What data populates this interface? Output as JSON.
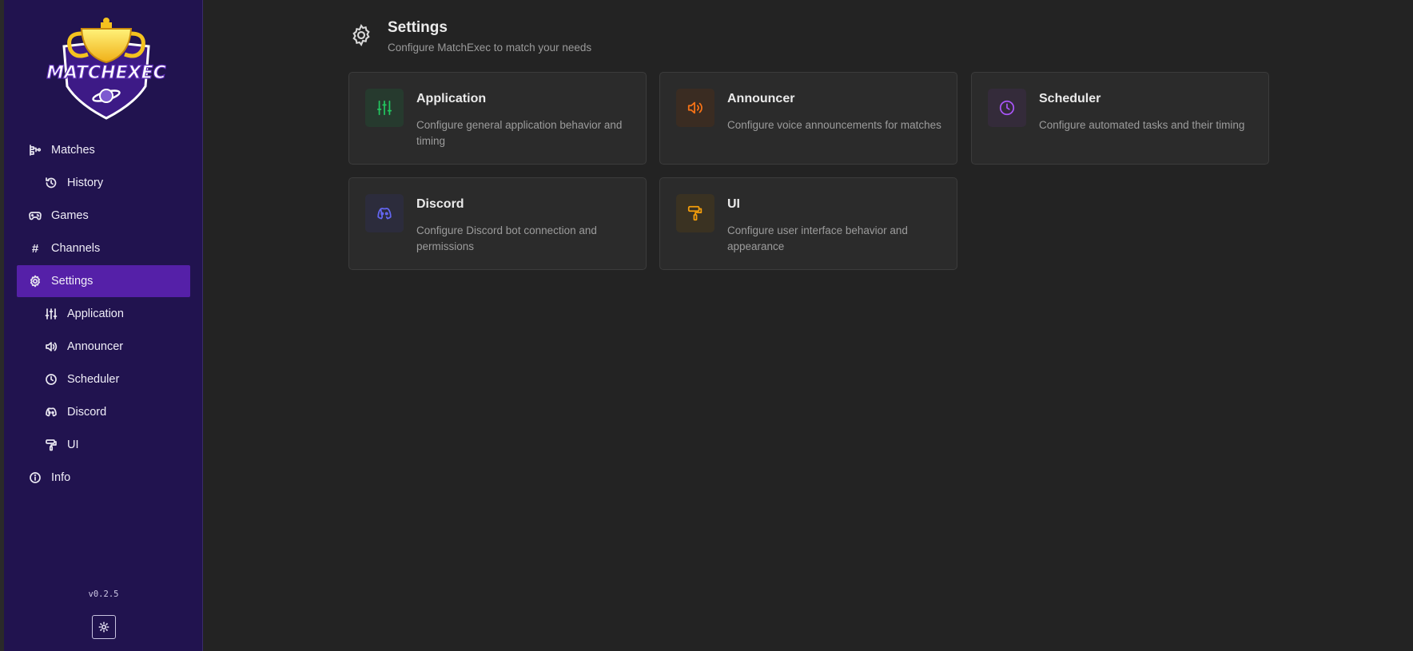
{
  "sidebar": {
    "logo_text": "MATCHEXEC",
    "items": [
      {
        "label": "Matches"
      },
      {
        "label": "History"
      },
      {
        "label": "Games"
      },
      {
        "label": "Channels"
      },
      {
        "label": "Settings"
      },
      {
        "label": "Application"
      },
      {
        "label": "Announcer"
      },
      {
        "label": "Scheduler"
      },
      {
        "label": "Discord"
      },
      {
        "label": "UI"
      },
      {
        "label": "Info"
      }
    ],
    "version": "v0.2.5",
    "active_item": "Settings"
  },
  "header": {
    "title": "Settings",
    "subtitle": "Configure MatchExec to match your needs"
  },
  "cards": [
    {
      "title": "Application",
      "description": "Configure general application behavior and timing",
      "icon": "sliders-icon",
      "color": "#22c55e"
    },
    {
      "title": "Announcer",
      "description": "Configure voice announcements for matches",
      "icon": "speaker-icon",
      "color": "#f97316"
    },
    {
      "title": "Scheduler",
      "description": "Configure automated tasks and their timing",
      "icon": "clock-icon",
      "color": "#a855f7"
    },
    {
      "title": "Discord",
      "description": "Configure Discord bot connection and permissions",
      "icon": "discord-icon",
      "color": "#6366f1"
    },
    {
      "title": "UI",
      "description": "Configure user interface behavior and appearance",
      "icon": "paint-roller-icon",
      "color": "#f59e0b"
    }
  ],
  "colors": {
    "sidebar_bg": "#21134f",
    "active_bg": "#5520a8",
    "page_bg": "#232323",
    "card_bg": "#2b2b2b"
  }
}
